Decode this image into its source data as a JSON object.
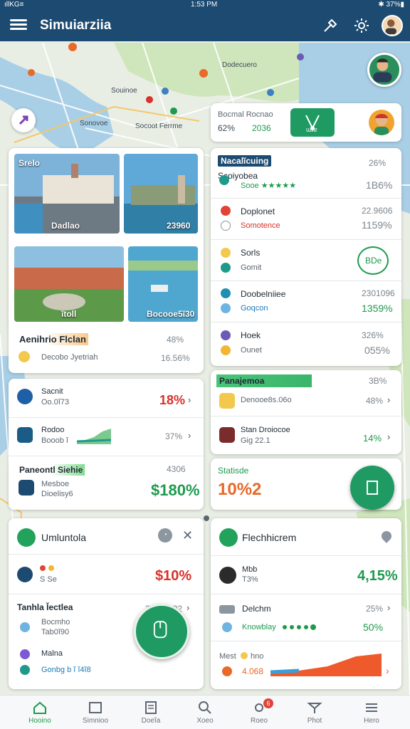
{
  "status_bar": {
    "left": "ıllKG≡",
    "time": "1:53 PM",
    "right": "✱ 37%▮"
  },
  "app_bar": {
    "title": "Simuiarziia"
  },
  "map": {
    "labels": [
      "Dodecuero",
      "Souinoe",
      "Socoot Ferrme",
      "Sonovoe"
    ]
  },
  "top_right_card": {
    "line1": "Bocmal Rocnao",
    "val1": "62%",
    "val2": "2036",
    "button_label": "ɯɹɐ"
  },
  "photos_card": {
    "photos": [
      {
        "caption": "Srelo",
        "sub": "Dadlao"
      },
      {
        "caption": "23960"
      },
      {
        "caption": "ĭtoll"
      },
      {
        "caption": "Bocooe5ĭ30"
      }
    ],
    "footer_title": "Aenihrio Flclan",
    "footer_sub": "Decobo Jyetriah",
    "footer_val1": "48%",
    "footer_val2": "16.56%"
  },
  "list_card": {
    "header": "Nacalĭcuing",
    "rows": [
      {
        "title": "Scoiyobea",
        "sub": "Sooe ★★★★★",
        "val_top": "26%",
        "val": "1B6%"
      },
      {
        "title": "Doplonet",
        "sub": "Somotence",
        "val_top": "22.9606",
        "val": "1159%"
      },
      {
        "title": "Sorls",
        "sub": "Gomit",
        "val_badge": "BDe"
      },
      {
        "title": "Doobelniiee",
        "sub": "Goqcon",
        "val_top": "2301096",
        "val": "1359%"
      },
      {
        "title": "Hoek",
        "sub": "Ounet",
        "val_top": "326%",
        "val": "055%"
      }
    ]
  },
  "left_stats_card": {
    "rows": [
      {
        "title": "Sacnit",
        "sub": "Oo.0ĭ73",
        "val": "18%"
      },
      {
        "title": "Rodoo",
        "sub": "Booob ĭ",
        "val": "37%"
      }
    ],
    "panel_title": "Paneontl Siehie",
    "panel_val_top": "4306",
    "panel_sub1": "Mesboe",
    "panel_sub2": "Dioelisy6",
    "panel_val": "$180%"
  },
  "right_stats_card": {
    "header": "Panajemoa",
    "rows": [
      {
        "title": "Denooe8s.06o",
        "val_top": "3B%",
        "val": "48%"
      },
      {
        "title": "Stan Droiocoe",
        "sub": "Gig 22.1",
        "val": "14%"
      }
    ],
    "panel_title": "Statisde",
    "panel_val": "10%2"
  },
  "bottom_left_card": {
    "title": "Umluntola",
    "badge": "◔",
    "row1_sub": "S Se",
    "row1_val": "$10%",
    "section_title": "Tanhla Ĭectlea",
    "section_val": "2303 D02",
    "item1": "Bocmho",
    "item1_sub": "Tab0ĭ90",
    "item2": "Malna",
    "item2_sub": "Gonbg b ĭ ĭ4ĭ8"
  },
  "bottom_right_card": {
    "title": "Flechhicrem",
    "row1_title": "Mbb",
    "row1_sub": "T3%",
    "row1_val": "4,15%",
    "row2_title": "Delchm",
    "row2_val_top": "25%",
    "row2_sub": "Knowblay",
    "row2_val": "50%",
    "row3_title": "Mest",
    "row3_sub": "hno",
    "row3_val": "4.068"
  },
  "bottom_nav": {
    "items": [
      "Hooino",
      "Simnioo",
      "Doeĭa",
      "Xoeo",
      "Roeo",
      "Phot",
      "Hero"
    ],
    "badge": "6"
  },
  "colors": {
    "app_bar": "#1c4a70",
    "accent_green": "#1e9a4e",
    "accent_red": "#d9312b",
    "accent_orange": "#e8692a"
  }
}
